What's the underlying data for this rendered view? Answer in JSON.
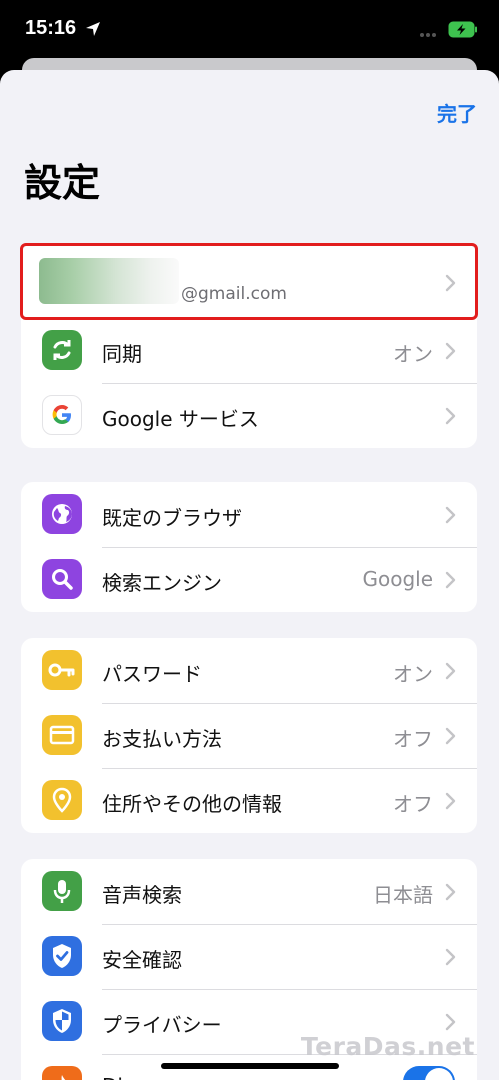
{
  "status_bar": {
    "time": "15:16"
  },
  "header": {
    "done_label": "完了",
    "title": "設定"
  },
  "account": {
    "email": "@gmail.com"
  },
  "groups": [
    {
      "items": [
        {
          "label": "同期",
          "value": "オン",
          "icon": "sync-icon",
          "color": "#43a047"
        },
        {
          "label": "Google サービス",
          "value": "",
          "icon": "google-g-icon",
          "color": "#ffffff"
        }
      ]
    },
    {
      "items": [
        {
          "label": "既定のブラウザ",
          "value": "",
          "icon": "globe-icon",
          "color": "#8e44e0"
        },
        {
          "label": "検索エンジン",
          "value": "Google",
          "icon": "search-icon",
          "color": "#8e44e0"
        }
      ]
    },
    {
      "items": [
        {
          "label": "パスワード",
          "value": "オン",
          "icon": "key-icon",
          "color": "#f2c12e"
        },
        {
          "label": "お支払い方法",
          "value": "オフ",
          "icon": "card-icon",
          "color": "#f2c12e"
        },
        {
          "label": "住所やその他の情報",
          "value": "オフ",
          "icon": "location-pin-icon",
          "color": "#f2c12e"
        }
      ]
    },
    {
      "items": [
        {
          "label": "音声検索",
          "value": "日本語",
          "icon": "microphone-icon",
          "color": "#43a047"
        },
        {
          "label": "安全確認",
          "value": "",
          "icon": "shield-check-icon",
          "color": "#2f6fe0"
        },
        {
          "label": "プライバシー",
          "value": "",
          "icon": "shield-icon",
          "color": "#2f6fe0"
        },
        {
          "label": "Di",
          "value": "",
          "icon": "fire-icon",
          "color": "#ef6c1a",
          "toggle": true
        }
      ]
    }
  ],
  "watermark": "TeraDas.net"
}
